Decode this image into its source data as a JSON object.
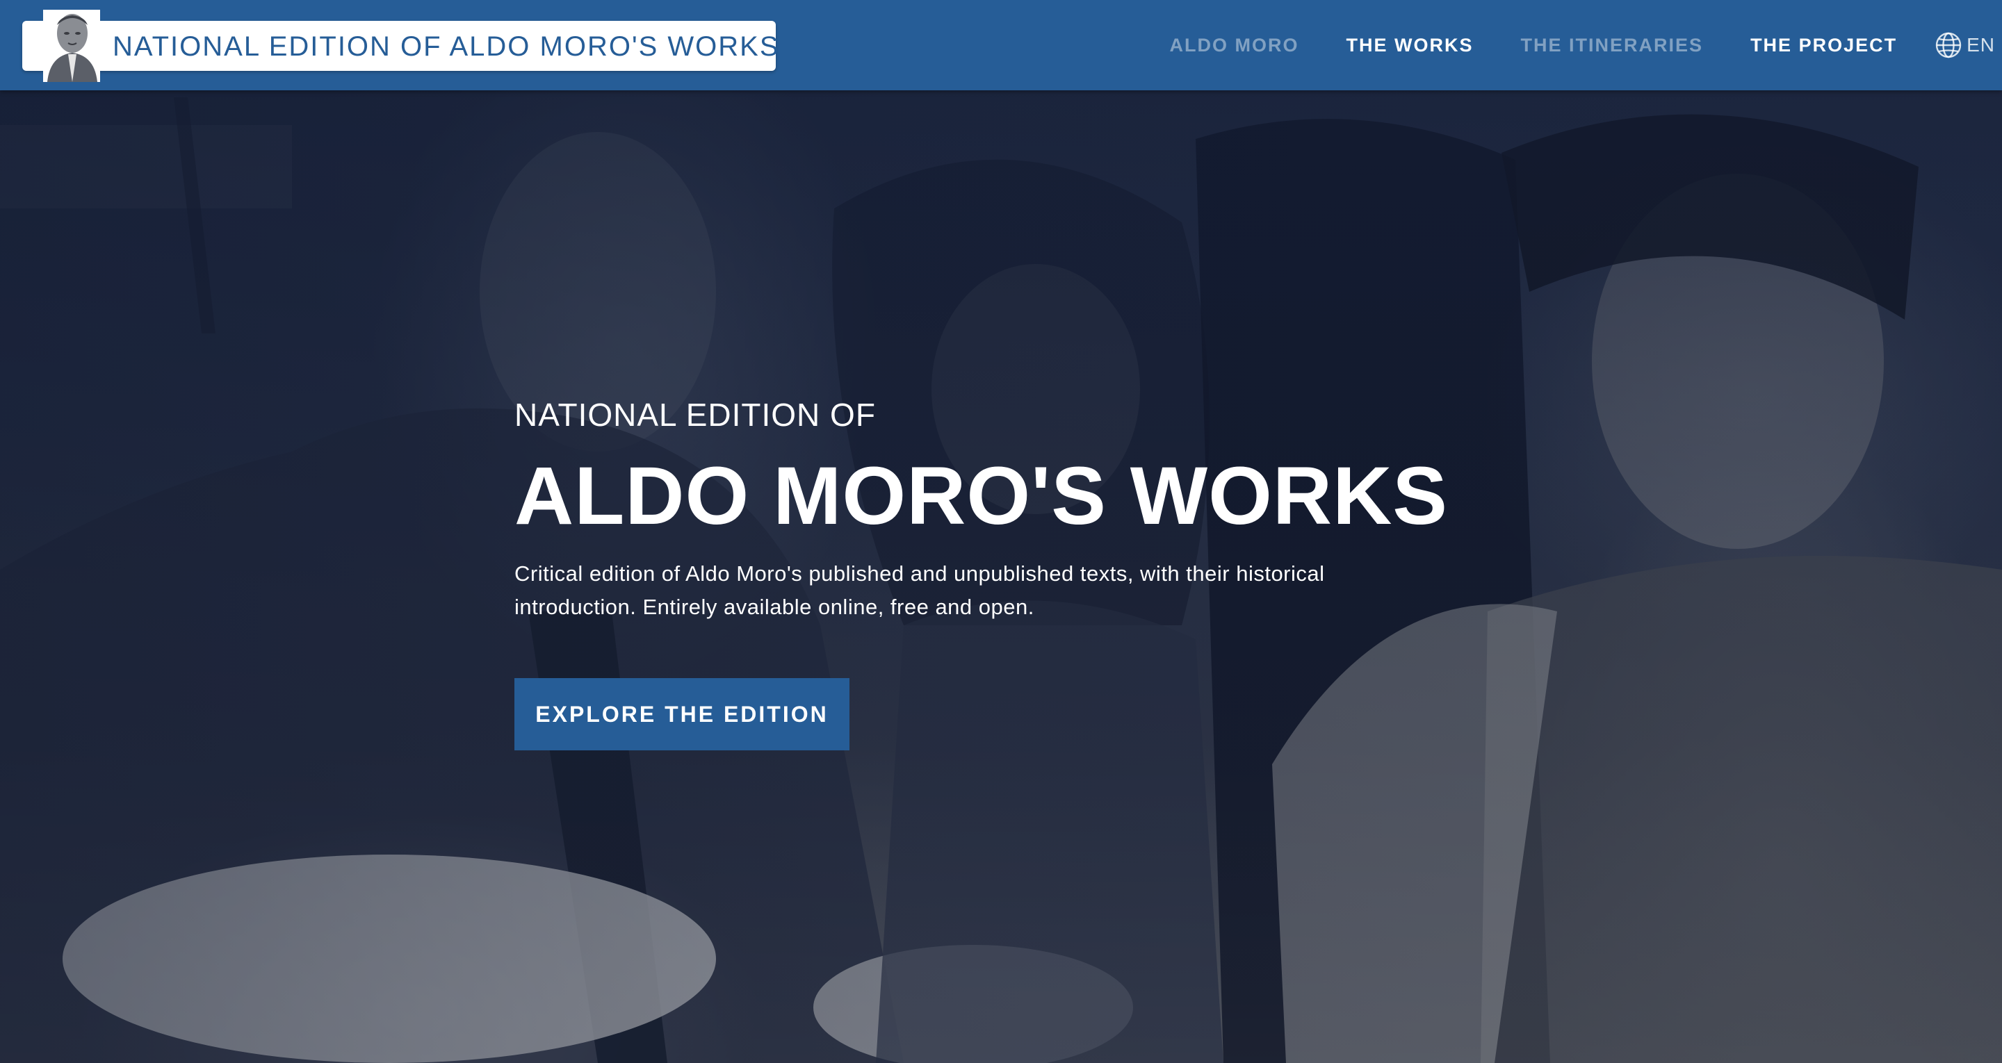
{
  "header": {
    "site_title": "NATIONAL EDITION OF ALDO MORO'S WORKS",
    "logo_icon": "aldo-moro-portrait",
    "nav": [
      {
        "label": "ALDO MORO",
        "active": false
      },
      {
        "label": "THE WORKS",
        "active": true
      },
      {
        "label": "THE ITINERARIES",
        "active": false
      },
      {
        "label": "THE PROJECT",
        "active": true
      }
    ],
    "language": {
      "icon": "globe-icon",
      "label": "EN"
    }
  },
  "hero": {
    "eyebrow": "NATIONAL EDITION OF",
    "title": "ALDO MORO'S WORKS",
    "description": "Critical edition of Aldo Moro's published and unpublished texts, with their historical introduction. Entirely available online, free and open.",
    "cta_label": "EXPLORE THE EDITION",
    "background": "black-and-white-group-photo"
  },
  "colors": {
    "brand_blue": "#265d97",
    "white": "#ffffff"
  }
}
